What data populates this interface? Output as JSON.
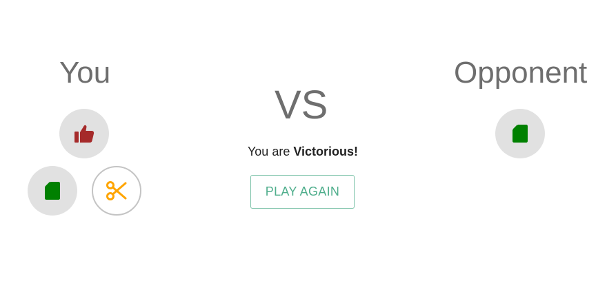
{
  "player": {
    "title": "You",
    "choices": [
      {
        "name": "rock",
        "icon": "thumbs-up-icon",
        "color": "#a52a2a",
        "selected": false
      },
      {
        "name": "paper",
        "icon": "file-icon",
        "color": "#008000",
        "selected": false
      },
      {
        "name": "scissors",
        "icon": "scissors-icon",
        "color": "#ffa500",
        "selected": true
      }
    ]
  },
  "opponent": {
    "title": "Opponent",
    "choice": {
      "name": "paper",
      "icon": "file-icon",
      "color": "#008000"
    }
  },
  "center": {
    "vs_label": "VS",
    "result_prefix": "You are",
    "result_outcome": "Victorious!",
    "play_again_label": "PLAY AGAIN"
  },
  "colors": {
    "heading": "#6e6e6e",
    "circle": "#e1e1e1",
    "accent": "#4fae8c"
  }
}
